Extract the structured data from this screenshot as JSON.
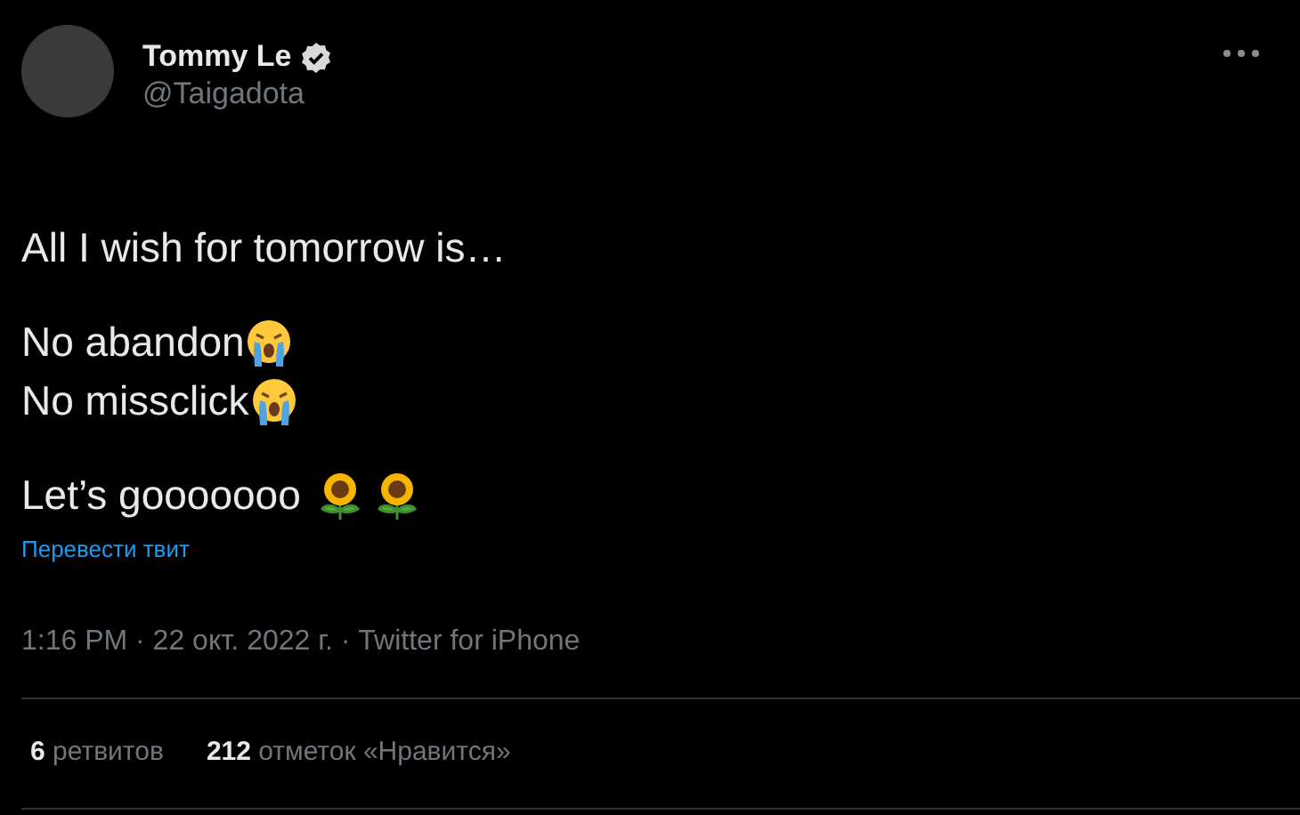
{
  "author": {
    "name": "Tommy Le",
    "verified": true,
    "handle": "@Taigadota"
  },
  "lines": [
    {
      "text": "All I wish for tomorrow is…",
      "kind": "plain"
    },
    {
      "kind": "blank"
    },
    {
      "text": "No abandon",
      "kind": "crying"
    },
    {
      "text": "No missclick",
      "kind": "crying"
    },
    {
      "kind": "blank"
    },
    {
      "text": "Let’s gooooooo",
      "kind": "sunflowers"
    }
  ],
  "translate_link": "Перевести твит",
  "meta": "1:16 PM · 22 окт. 2022 г. · Twitter for iPhone",
  "stats": [
    {
      "count": "6",
      "label": "ретвитов"
    },
    {
      "count": "212",
      "label": "отметок «Нравится»"
    }
  ]
}
